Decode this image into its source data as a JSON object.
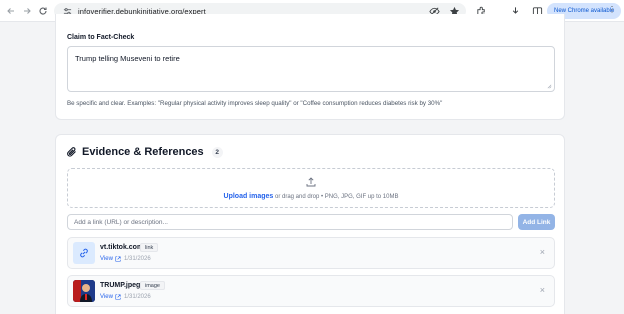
{
  "browser": {
    "url": "infoverifier.debunkinitiative.org/expert",
    "update_label": "New Chrome available",
    "more_label": "⋮"
  },
  "claim": {
    "label": "Claim to Fact-Check",
    "value": "Trump telling Museveni to retire",
    "hint": "Be specific and clear. Examples: \"Regular physical activity improves sleep quality\" or \"Coffee consumption reduces diabetes risk by 30%\""
  },
  "evidence": {
    "title": "Evidence & References",
    "count": "2",
    "upload_link": "Upload images",
    "upload_hint": " or drag and drop • PNG, JPG, GIF up to 10MB",
    "link_placeholder": "Add a link (URL) or description...",
    "add_link_label": "Add Link",
    "items": [
      {
        "name": "vt.tiktok.com",
        "type": "link",
        "view": "View",
        "date": "1/31/2026",
        "icon": "link-icon"
      },
      {
        "name": "TRUMP.jpeg",
        "type": "image",
        "view": "View",
        "date": "1/31/2026",
        "icon": "image-thumbnail"
      }
    ],
    "remove_label": "×"
  }
}
